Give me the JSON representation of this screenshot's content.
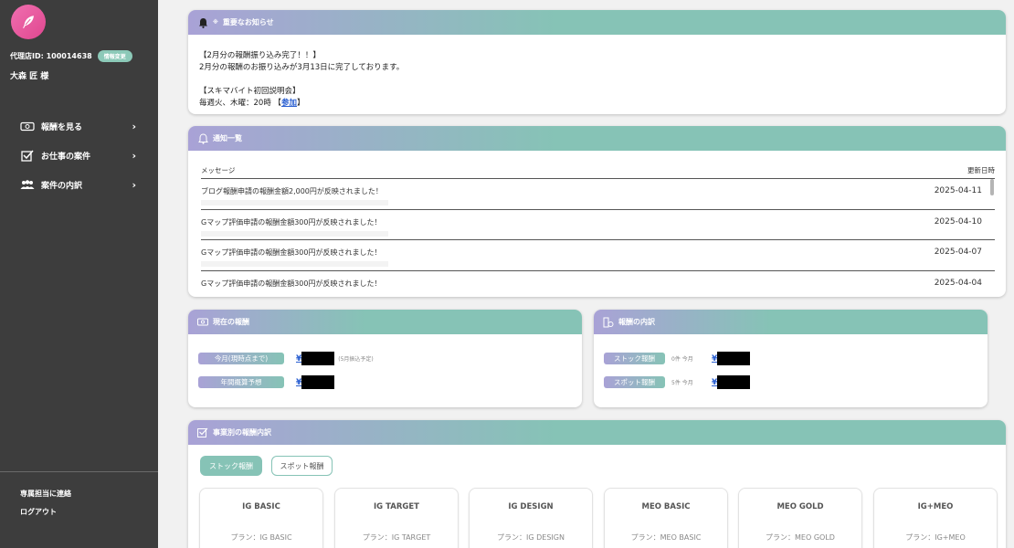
{
  "sidebar": {
    "agent_id_label": "代理店ID: 100014638",
    "edit_badge": "情報変更",
    "user_name": "大森 匠 様",
    "nav": [
      {
        "label": "報酬を見る",
        "icon": "money-icon"
      },
      {
        "label": "お仕事の案件",
        "icon": "checkbox-icon"
      },
      {
        "label": "案件の内訳",
        "icon": "people-icon"
      }
    ],
    "contact_link": "専属担当に連絡",
    "logout_link": "ログアウト"
  },
  "important_notice": {
    "title": "重要なお知らせ",
    "lines": [
      "【2月分の報酬振り込み完了！！】",
      "2月分の報酬のお振り込みが3月13日に完了しております。",
      "",
      "【スキマバイト初回説明会】"
    ],
    "schedule": "毎週火、木曜：20時 【",
    "join_link": "参加",
    "schedule_end": "】"
  },
  "notifications": {
    "title": "通知一覧",
    "col_message": "メッセージ",
    "col_date": "更新日時",
    "rows": [
      {
        "message": "ブログ報酬申請の報酬金額2,000円が反映されました！",
        "date": "2025-04-11"
      },
      {
        "message": "Gマップ評価申請の報酬金額300円が反映されました！",
        "date": "2025-04-10"
      },
      {
        "message": "Gマップ評価申請の報酬金額300円が反映されました！",
        "date": "2025-04-07"
      },
      {
        "message": "Gマップ評価申請の報酬金額300円が反映されました！",
        "date": "2025-04-04"
      }
    ]
  },
  "current_reward": {
    "title": "現在の報酬",
    "this_month_label": "今月(現時点まで)",
    "this_month_note": "(5月振込予定)",
    "annual_label": "年間概算予想",
    "yen": "¥"
  },
  "reward_breakdown": {
    "title": "報酬の内訳",
    "stock_label": "ストック報酬",
    "stock_count": "0件 今月",
    "spot_label": "スポット報酬",
    "spot_count": "5件 今月",
    "yen": "¥"
  },
  "business_breakdown": {
    "title": "事業別の報酬内訳",
    "tabs": [
      "ストック報酬",
      "スポット報酬"
    ],
    "plans": [
      {
        "name": "IG BASIC",
        "plan": "プラン：IG BASIC"
      },
      {
        "name": "IG TARGET",
        "plan": "プラン：IG TARGET"
      },
      {
        "name": "IG DESIGN",
        "plan": "プラン：IG DESIGN"
      },
      {
        "name": "MEO BASIC",
        "plan": "プラン：MEO BASIC"
      },
      {
        "name": "MEO GOLD",
        "plan": "プラン：MEO GOLD"
      },
      {
        "name": "IG+MEO",
        "plan": "プラン：IG+MEO"
      }
    ]
  },
  "colors": {
    "accent_teal": "#86c3b6",
    "accent_purple": "#a9a2d6",
    "sidebar_bg": "#3d3d3d",
    "link_blue": "#2a5fd1"
  }
}
